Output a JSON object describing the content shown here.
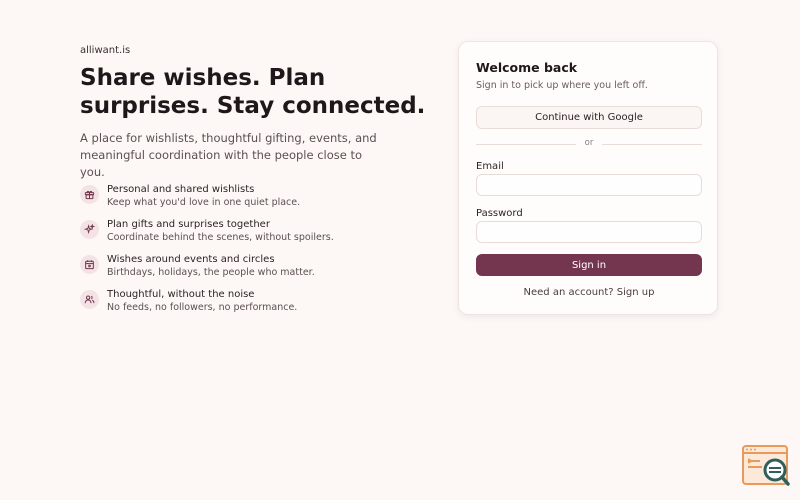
{
  "brand": "alliwant.is",
  "hero": {
    "title": "Share wishes. Plan surprises. Stay connected.",
    "subtitle": "A place for wishlists, thoughtful gifting, events, and meaningful coordination with the people close to you."
  },
  "features": [
    {
      "icon": "gift-icon",
      "title": "Personal and shared wishlists",
      "desc": "Keep what you'd love in one quiet place."
    },
    {
      "icon": "sparkles-icon",
      "title": "Plan gifts and surprises together",
      "desc": "Coordinate behind the scenes, without spoilers."
    },
    {
      "icon": "calendar-icon",
      "title": "Wishes around events and circles",
      "desc": "Birthdays, holidays, the people who matter."
    },
    {
      "icon": "users-icon",
      "title": "Thoughtful, without the noise",
      "desc": "No feeds, no followers, no performance."
    }
  ],
  "login": {
    "title": "Welcome back",
    "subtitle": "Sign in to pick up where you left off.",
    "google_label": "Continue with Google",
    "divider": "or",
    "email_label": "Email",
    "email_value": "",
    "password_label": "Password",
    "password_value": "",
    "signin_label": "Sign in",
    "signup_text": "Need an account? Sign up"
  },
  "colors": {
    "background": "#fdf8f6",
    "accent": "#74364f",
    "icon_bg": "#f3e3e5"
  }
}
